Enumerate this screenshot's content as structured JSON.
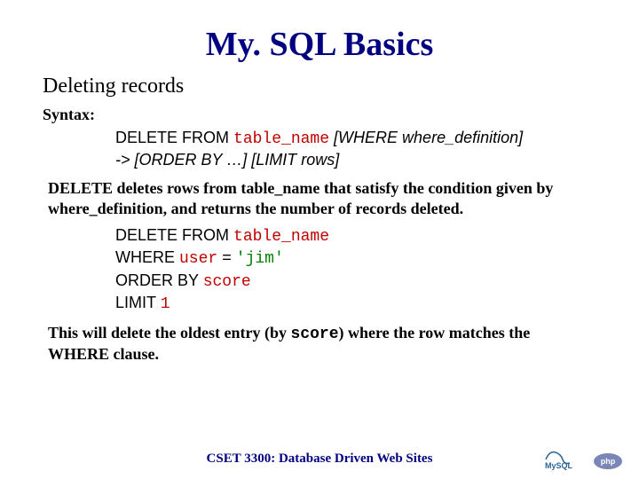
{
  "title": "My. SQL Basics",
  "subhead": "Deleting records",
  "syntax_label": "Syntax:",
  "syntax": {
    "line1_kw": "DELETE FROM ",
    "line1_field": "table_name",
    "line1_rest": " [WHERE where_definition]",
    "line2": "-> [ORDER BY …] [LIMIT rows]"
  },
  "desc": {
    "pre": "DELETE deletes rows from ",
    "tbl": "table_name",
    "mid": " that satisfy the condition given by ",
    "wd": "where_definition",
    "post": ", and returns the number of records deleted."
  },
  "example": {
    "l1_kw": "DELETE FROM ",
    "l1_field": "table_name",
    "l2_kw": "WHERE ",
    "l2_field": "user",
    "l2_eq": " = ",
    "l2_val": "'jim'",
    "l3_kw": "ORDER BY ",
    "l3_field": "score",
    "l4_kw": "LIMIT ",
    "l4_val": "1"
  },
  "closing": {
    "pre": "This will delete the oldest entry (by ",
    "score": "score",
    "post": ") where the row matches the WHERE clause."
  },
  "footer": "CSET 3300: Database Driven Web Sites"
}
